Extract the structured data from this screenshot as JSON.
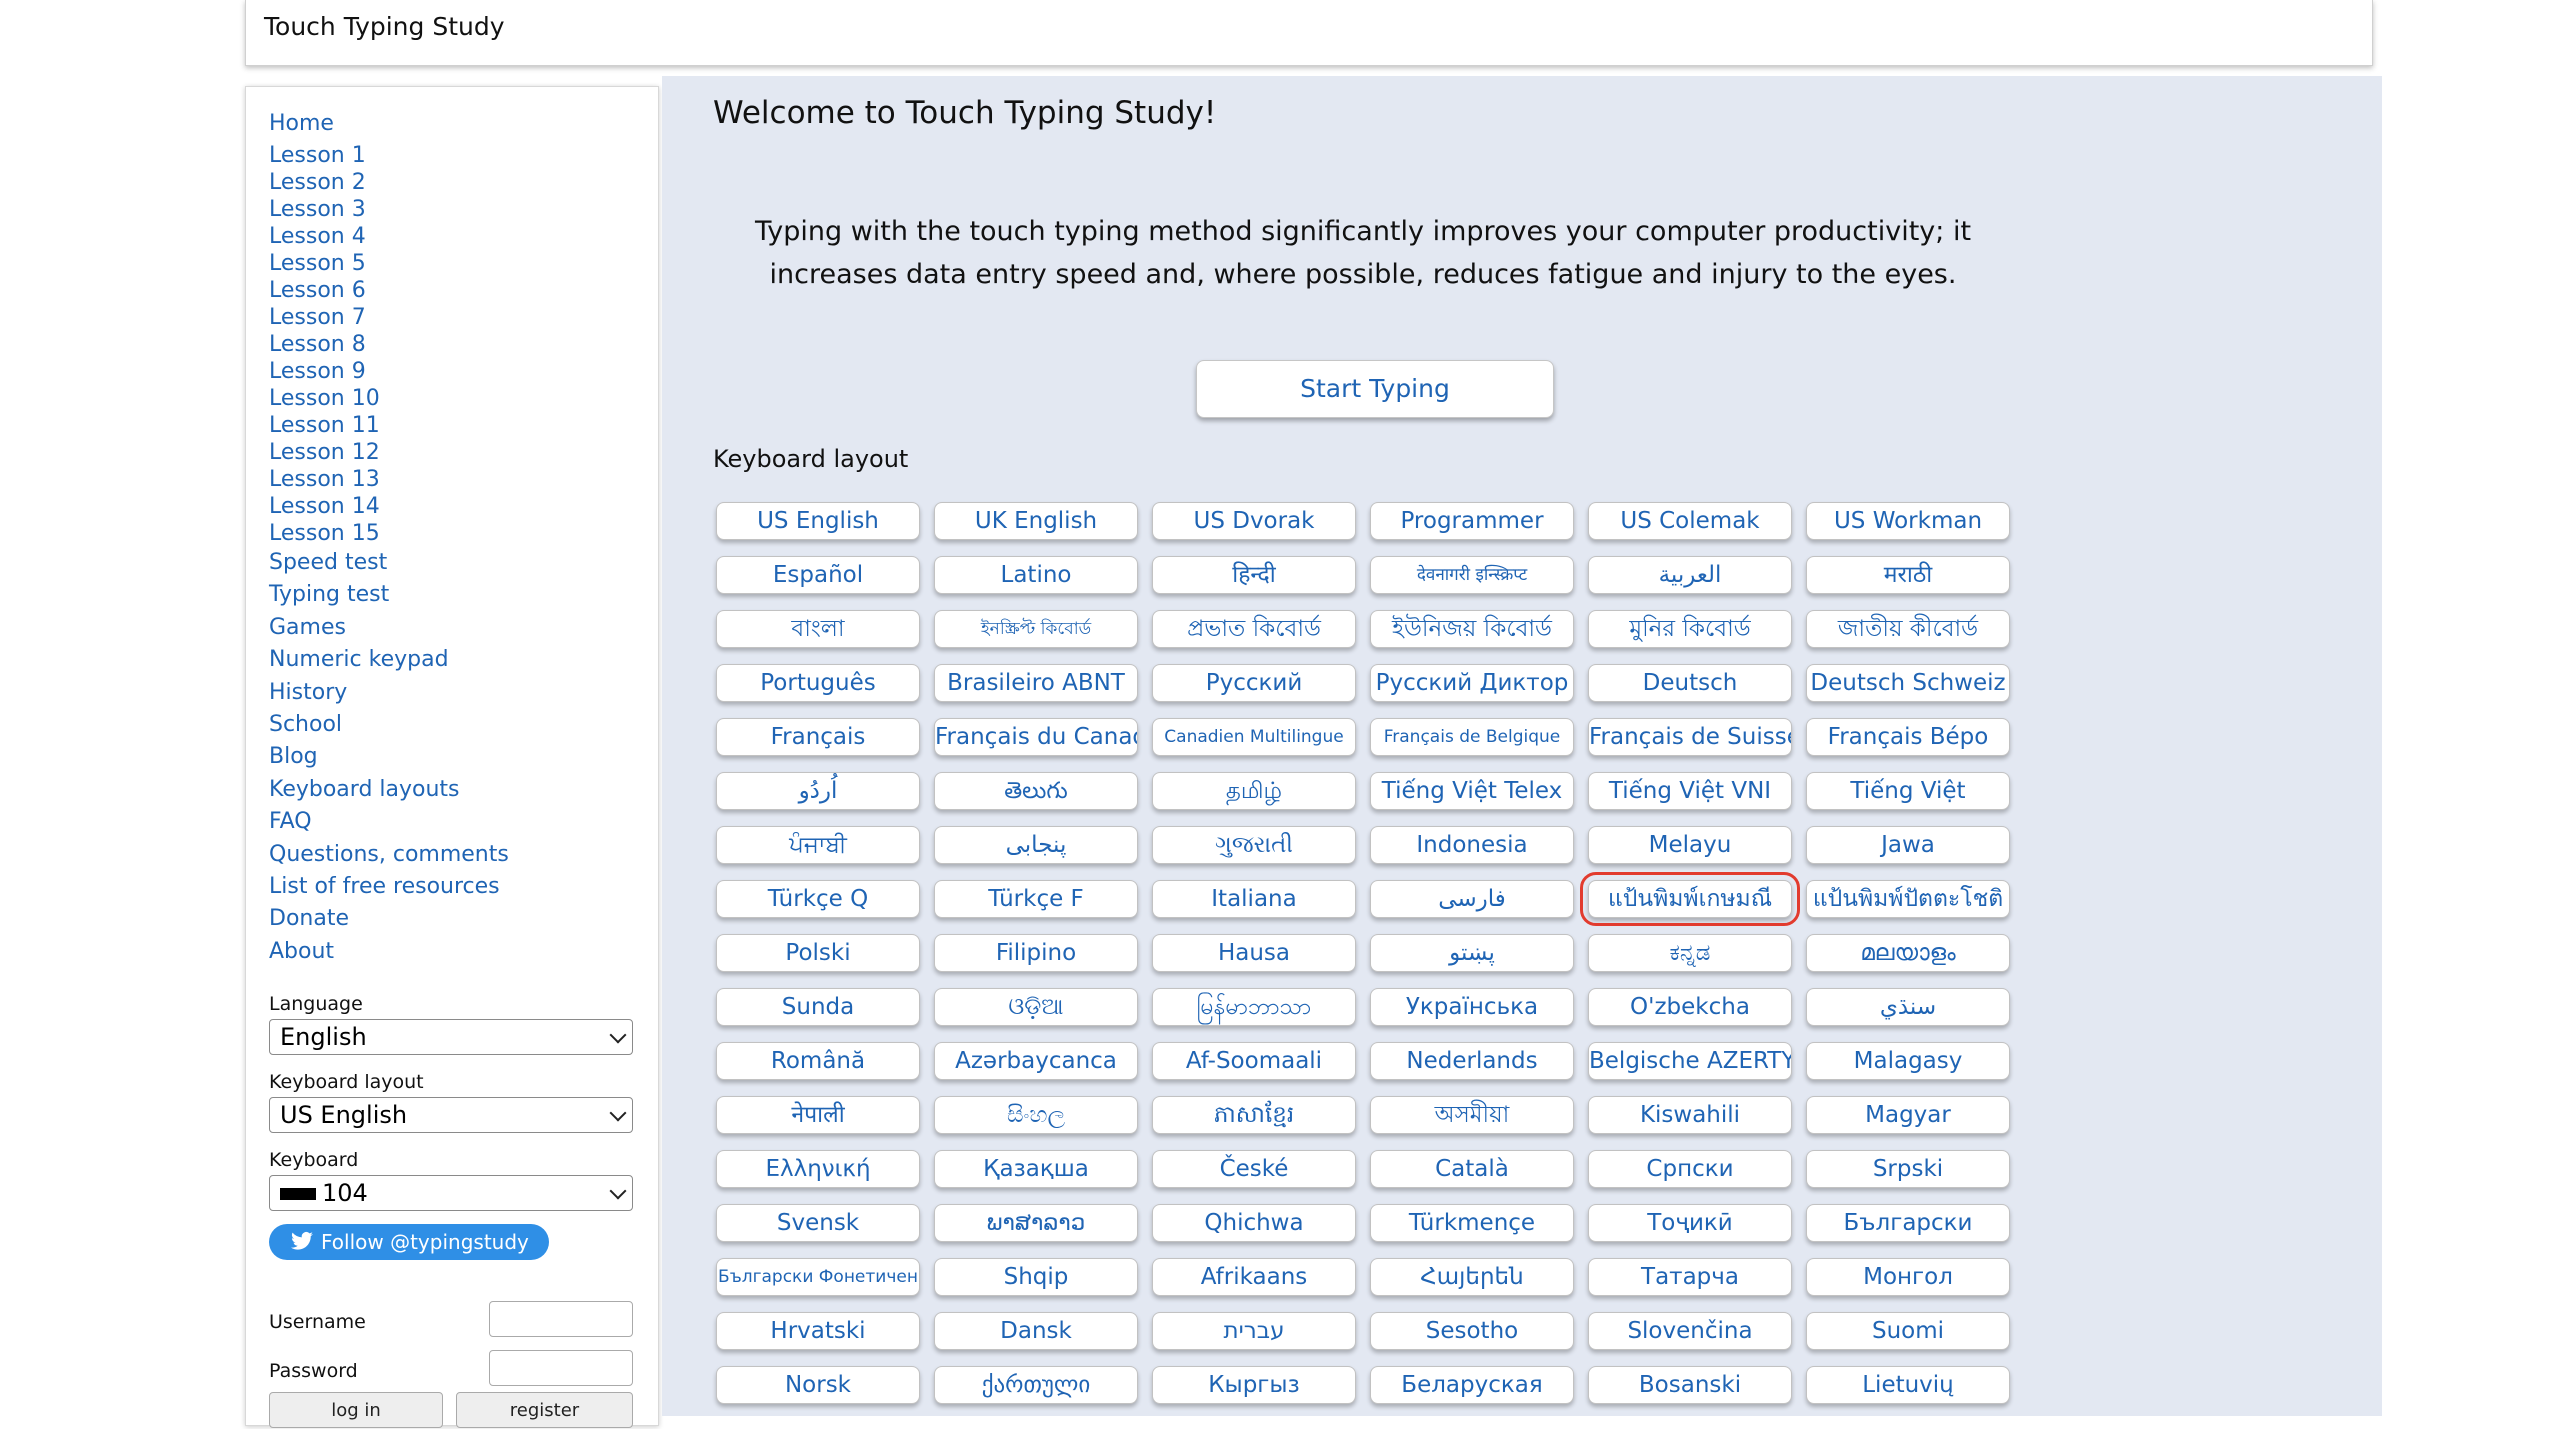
{
  "header": {
    "title": "Touch Typing Study"
  },
  "sidebar": {
    "nav": {
      "home": "Home",
      "lessons": [
        "Lesson 1",
        "Lesson 2",
        "Lesson 3",
        "Lesson 4",
        "Lesson 5",
        "Lesson 6",
        "Lesson 7",
        "Lesson 8",
        "Lesson 9",
        "Lesson 10",
        "Lesson 11",
        "Lesson 12",
        "Lesson 13",
        "Lesson 14",
        "Lesson 15"
      ],
      "other": [
        "Speed test",
        "Typing test",
        "Games",
        "Numeric keypad",
        "History",
        "School",
        "Blog",
        "Keyboard layouts",
        "FAQ",
        "Questions, comments",
        "List of free resources",
        "Donate",
        "About"
      ]
    },
    "language": {
      "label": "Language",
      "value": "English"
    },
    "keyboard_layout": {
      "label": "Keyboard layout",
      "value": "US English"
    },
    "keyboard": {
      "label": "Keyboard",
      "value": "104"
    },
    "follow": {
      "label": "Follow @typingstudy"
    },
    "login": {
      "username_label": "Username",
      "password_label": "Password",
      "login_button": "log in",
      "register_button": "register"
    }
  },
  "main": {
    "welcome": "Welcome to Touch Typing Study!",
    "intro": "Typing with the touch typing method significantly improves your computer productivity; it increases data entry speed and, where possible, reduces fatigue and injury to the eyes.",
    "start_button": "Start Typing",
    "keyboard_layout_title": "Keyboard layout",
    "selected_layout": "แป้นพิมพ์เกษมณี",
    "layouts": [
      "US English",
      "UK English",
      "US Dvorak",
      "Programmer",
      "US Colemak",
      "US Workman",
      "Español",
      "Latino",
      "हिन्दी",
      "देवनागरी इन्स्क्रिप्ट",
      "العربية",
      "मराठी",
      "বাংলা",
      "ইনস্ক্রিপ্ট কিবোর্ড",
      "প্রভাত কিবোর্ড",
      "ইউনিজয় কিবোর্ড",
      "মুনির কিবোর্ড",
      "জাতীয় কীবোর্ড",
      "Português",
      "Brasileiro ABNT",
      "Русский",
      "Русский Диктор",
      "Deutsch",
      "Deutsch Schweiz",
      "Français",
      "Français du Canada",
      "Canadien Multilingue",
      "Français de Belgique",
      "Français de Suisse",
      "Français Bépo",
      "اُردُو",
      "తెలుగు",
      "தமிழ்",
      "Tiếng Việt Telex",
      "Tiếng Việt VNI",
      "Tiếng Việt",
      "ਪੰਜਾਬੀ",
      "پنجابی",
      "ગુજરાતી",
      "Indonesia",
      "Melayu",
      "Jawa",
      "Türkçe Q",
      "Türkçe F",
      "Italiana",
      "فارسی",
      "แป้นพิมพ์เกษมณี",
      "แป้นพิมพ์ปัตตะโชติ",
      "Polski",
      "Filipino",
      "Hausa",
      "پښتو",
      "ಕನ್ನಡ",
      "മലയാളം",
      "Sunda",
      "ଓଡ଼ିଆ",
      "မြန်မာဘာသာ",
      "Українська",
      "O'zbekcha",
      "سنڌي",
      "Română",
      "Azərbaycanca",
      "Af-Soomaali",
      "Nederlands",
      "Belgische AZERTY",
      "Malagasy",
      "नेपाली",
      "සිංහල",
      "ភាសាខ្មែរ",
      "অসমীয়া",
      "Kiswahili",
      "Magyar",
      "Ελληνική",
      "Қазақша",
      "České",
      "Català",
      "Српски",
      "Srpski",
      "Svensk",
      "ພາສາລາວ",
      "Qhichwa",
      "Türkmençe",
      "Тоҷикӣ",
      "Български",
      "Български Фонетичен",
      "Shqip",
      "Afrikaans",
      "Հայերեն",
      "Татарча",
      "Монгол",
      "Hrvatski",
      "Dansk",
      "עברית",
      "Sesotho",
      "Slovenčina",
      "Suomi",
      "Norsk",
      "ქართული",
      "Кыргыз",
      "Беларуская",
      "Bosanski",
      "Lietuvių"
    ]
  }
}
